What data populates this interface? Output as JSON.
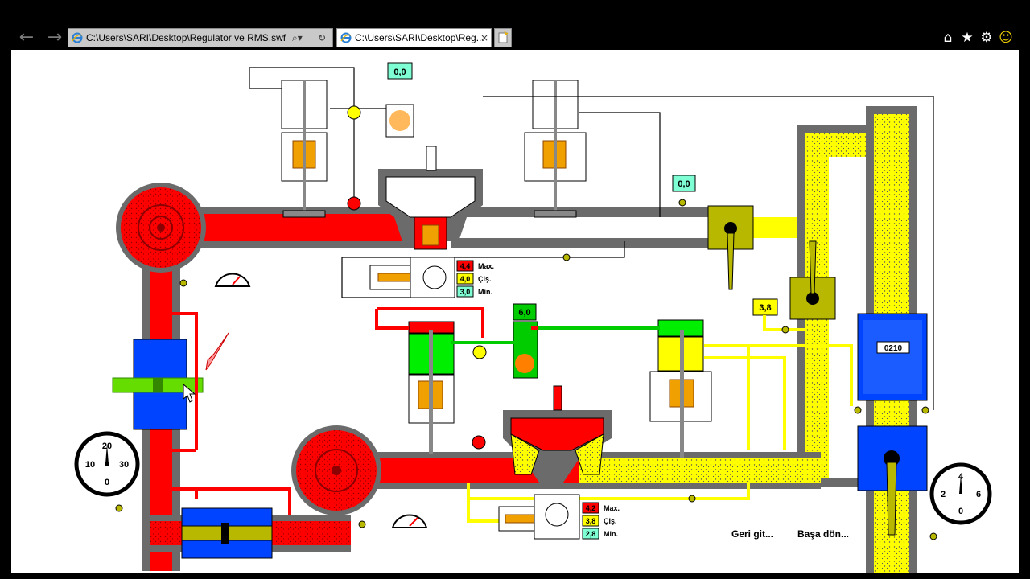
{
  "browser": {
    "tabs": [
      {
        "title": "C:\\Users\\SARI\\Desktop\\Regulator ve RMS.swf",
        "active": false
      },
      {
        "title": "C:\\Users\\SARI\\Desktop\\Reg...",
        "active": true
      }
    ],
    "icons": {
      "back": "back-arrow-icon",
      "forward": "forward-arrow-icon",
      "home": "home-icon",
      "favorites": "star-icon",
      "tools": "gear-icon",
      "feedback": "smiley-icon"
    }
  },
  "schematic": {
    "readouts": {
      "top_pilot": "0,0",
      "right_pilot": "0,0",
      "mid_pilot": "6,0",
      "yellow_side": "3,8"
    },
    "upper_legend": [
      {
        "value": "4,4",
        "label": "Max.",
        "color": "#ff0000"
      },
      {
        "value": "4,0",
        "label": "Çlş.",
        "color": "#ffff00"
      },
      {
        "value": "3,0",
        "label": "Min.",
        "color": "#7fffd4"
      }
    ],
    "lower_legend": [
      {
        "value": "4,2",
        "label": "Max.",
        "color": "#ff0000"
      },
      {
        "value": "3,8",
        "label": "Çlş.",
        "color": "#ffff00"
      },
      {
        "value": "2,8",
        "label": "Min.",
        "color": "#7fffd4"
      }
    ],
    "gauge_left": {
      "ticks": [
        "20",
        "10",
        "30",
        "0"
      ]
    },
    "gauge_right": {
      "ticks": [
        "4",
        "2",
        "6",
        "0"
      ]
    },
    "meter_counter": "0210",
    "links": {
      "back": "Geri git...",
      "home": "Başa dön..."
    }
  },
  "colors": {
    "high_pressure": "#ff0000",
    "low_pressure": "#ffff00",
    "pilot": "#00cc00",
    "meter": "#0044ff",
    "pipe_wall": "#6b6b6b"
  }
}
